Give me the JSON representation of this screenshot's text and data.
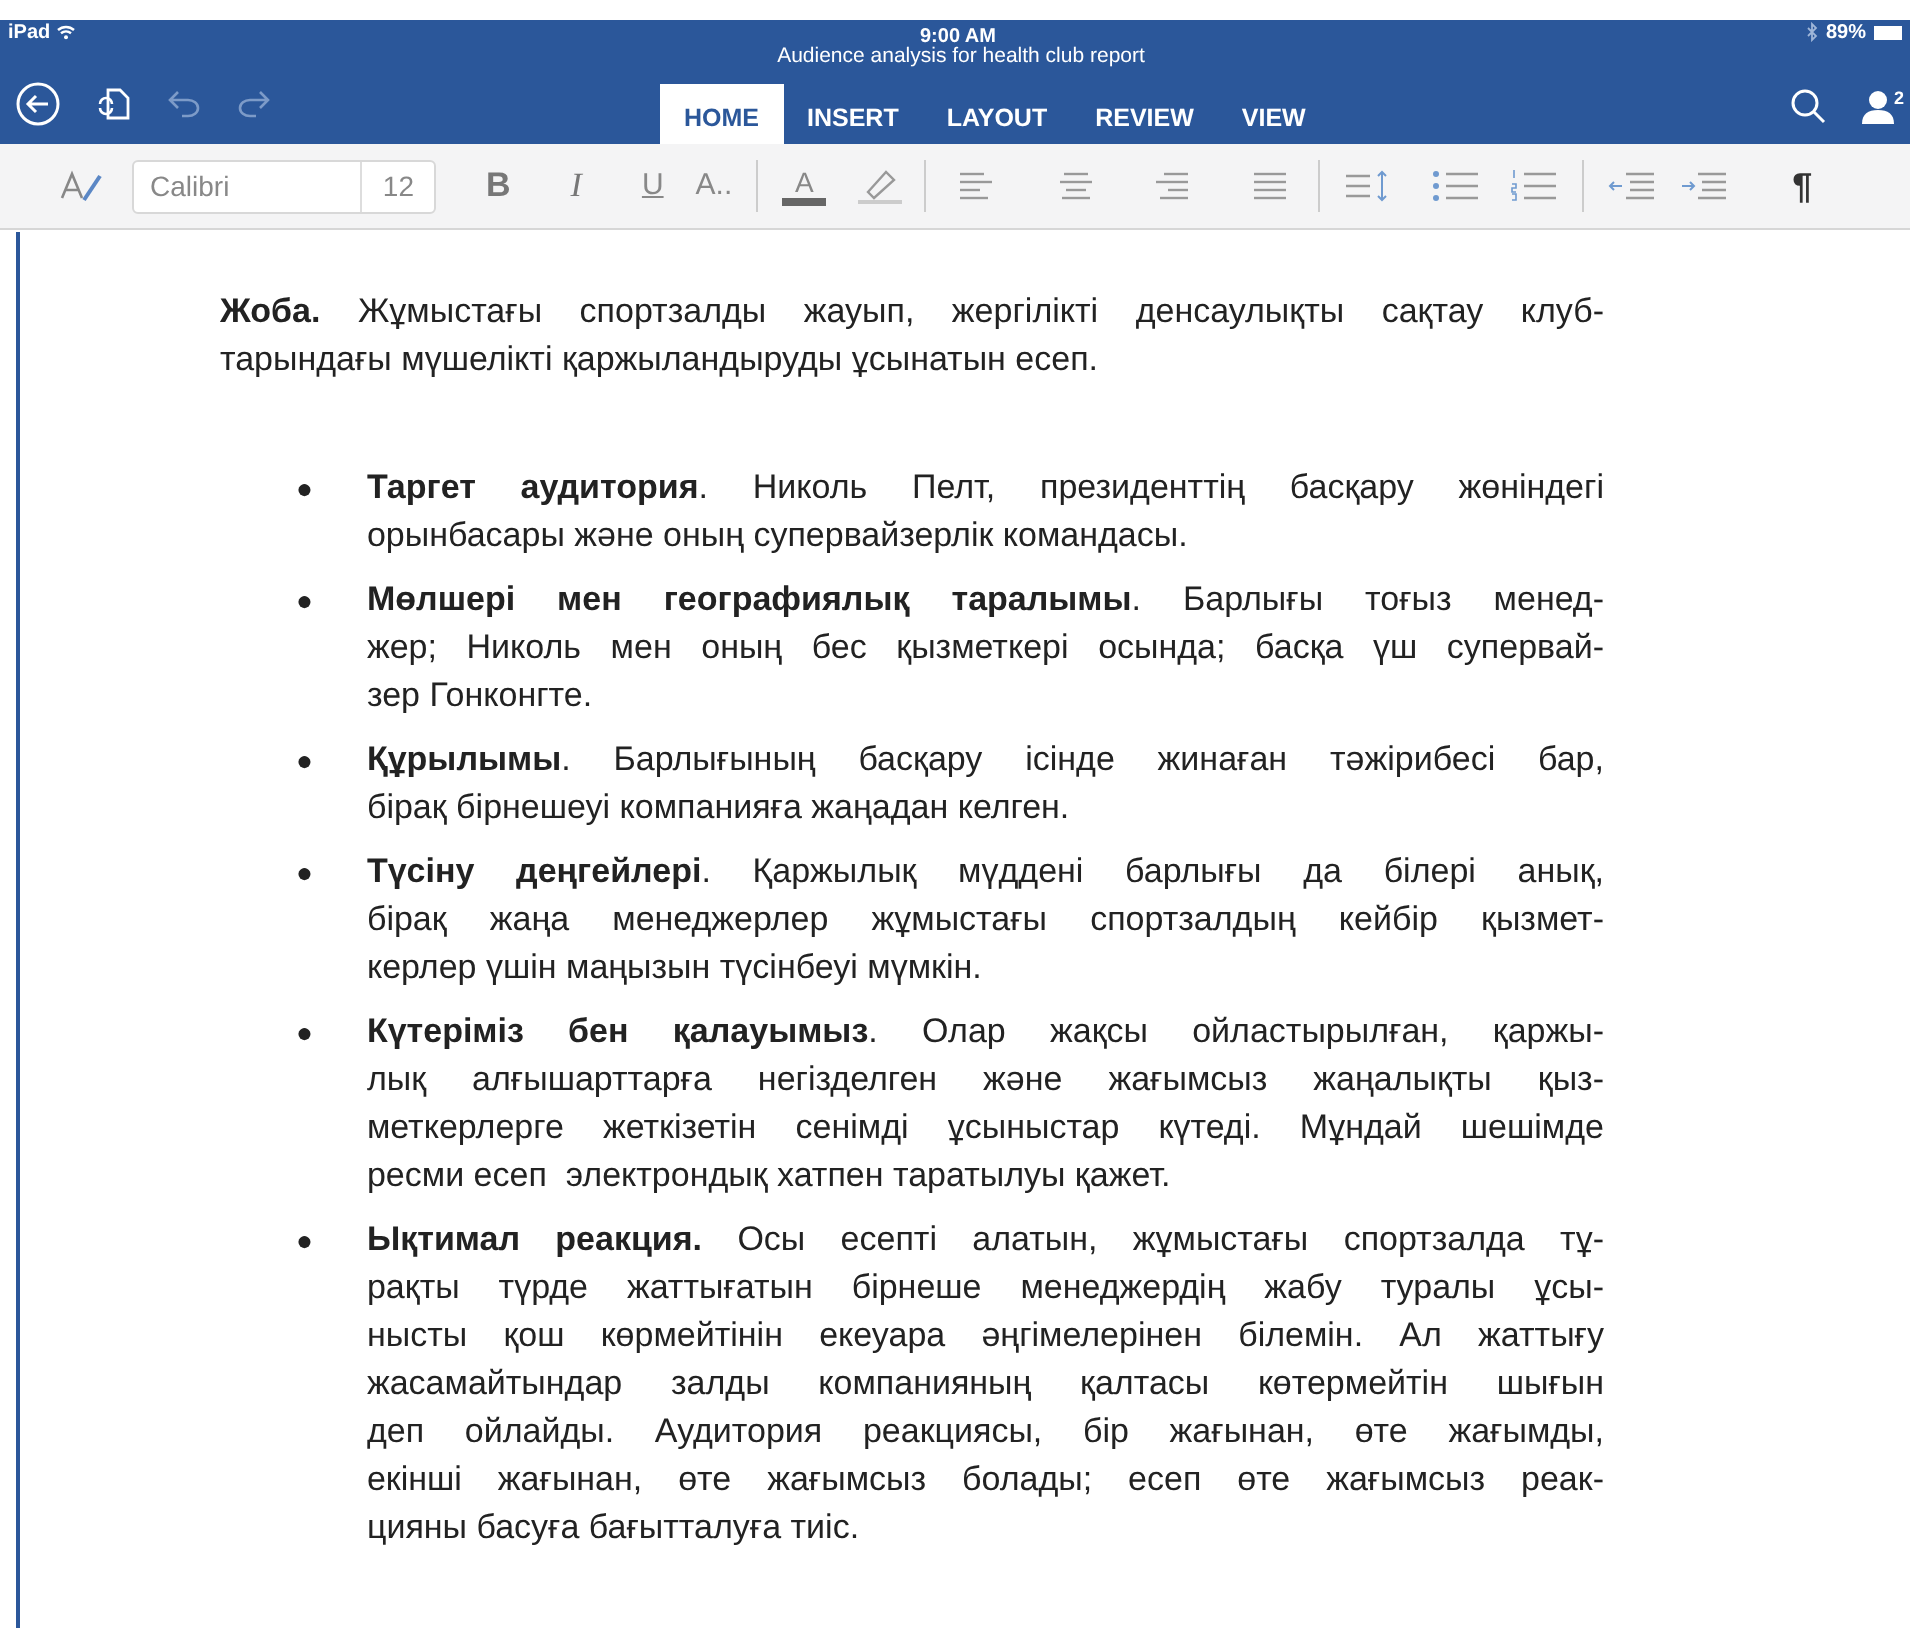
{
  "status_bar": {
    "device": "iPad",
    "time": "9:00 AM",
    "battery": "89%"
  },
  "window": {
    "title": "Audience analysis for health club report"
  },
  "tabs": [
    {
      "label": "HOME",
      "selected": true
    },
    {
      "label": "INSERT",
      "selected": false
    },
    {
      "label": "LAYOUT",
      "selected": false
    },
    {
      "label": "REVIEW",
      "selected": false
    },
    {
      "label": "VIEW",
      "selected": false
    }
  ],
  "account_badge": "2",
  "toolbar": {
    "font": "Calibri",
    "size": "12",
    "bold": "B",
    "italic": "I",
    "underline": "U",
    "text_effects": "A..",
    "font_color": "A",
    "show_marks": "¶"
  },
  "intro": {
    "lines": [
      "**Жоба.** Жұмыстағы спортзалды жауып, жергілікті денсаулықты сақтау клуб-",
      "тарындағы мүшелікті қаржыландыруды ұсынатын есеп."
    ]
  },
  "bullets": [
    {
      "bullet": "●",
      "lines": [
        "**Таргет аудитория**. Николь Пелт, президенттің басқару жөніндегі",
        "орынбасары және оның супервайзерлік командасы."
      ]
    },
    {
      "bullet": "●",
      "lines": [
        "**Мөлшері мен географиялық таралымы**. Барлығы тоғыз менед-",
        "жер; Николь мен оның бес қызметкері осында; басқа үш супервай-",
        "зер Гонконгте."
      ]
    },
    {
      "bullet": "●",
      "lines": [
        "**Құрылымы**. Барлығының басқару ісінде жинаған тәжірибесі бар,",
        "бірақ бірнешеуі компанияға жаңадан келген."
      ]
    },
    {
      "bullet": "●",
      "lines": [
        "**Түсіну деңгейлері**. Қаржылық мүддені барлығы да білері анық,",
        "бірақ жаңа менеджерлер жұмыстағы спортзалдың кейбір қызмет-",
        "керлер үшін маңызын түсінбеуі мүмкін."
      ]
    },
    {
      "bullet": "●",
      "lines": [
        "**Күтеріміз бен қалауымыз**. Олар жақсы ойластырылған, қаржы-",
        "лық алғышарттарға негізделген және жағымсыз жаңалықты қыз-",
        "меткерлерге жеткізетін сенімді ұсыныстар күтеді. Мұндай шешімде",
        "ресми есеп  электрондық хатпен таратылуы қажет."
      ]
    },
    {
      "bullet": "●",
      "lines": [
        "**Ықтимал реакция.** Осы есепті алатын, жұмыстағы спортзалда тұ-",
        "рақты түрде жаттығатын бірнеше менеджердің жабу туралы ұсы-",
        "нысты қош көрмейтінін екеуара әңгімелерінен білемін. Ал жаттығу",
        "жасамайтындар залды компанияның қалтасы көтермейтін шығын",
        "деп ойлайды. Аудитория реакциясы, бір жағынан, өте жағымды,",
        "екінші жағынан, өте жағымсыз болады; есеп өте жағымсыз реак-",
        "цияны басуға бағытталуға тиіс."
      ]
    }
  ]
}
